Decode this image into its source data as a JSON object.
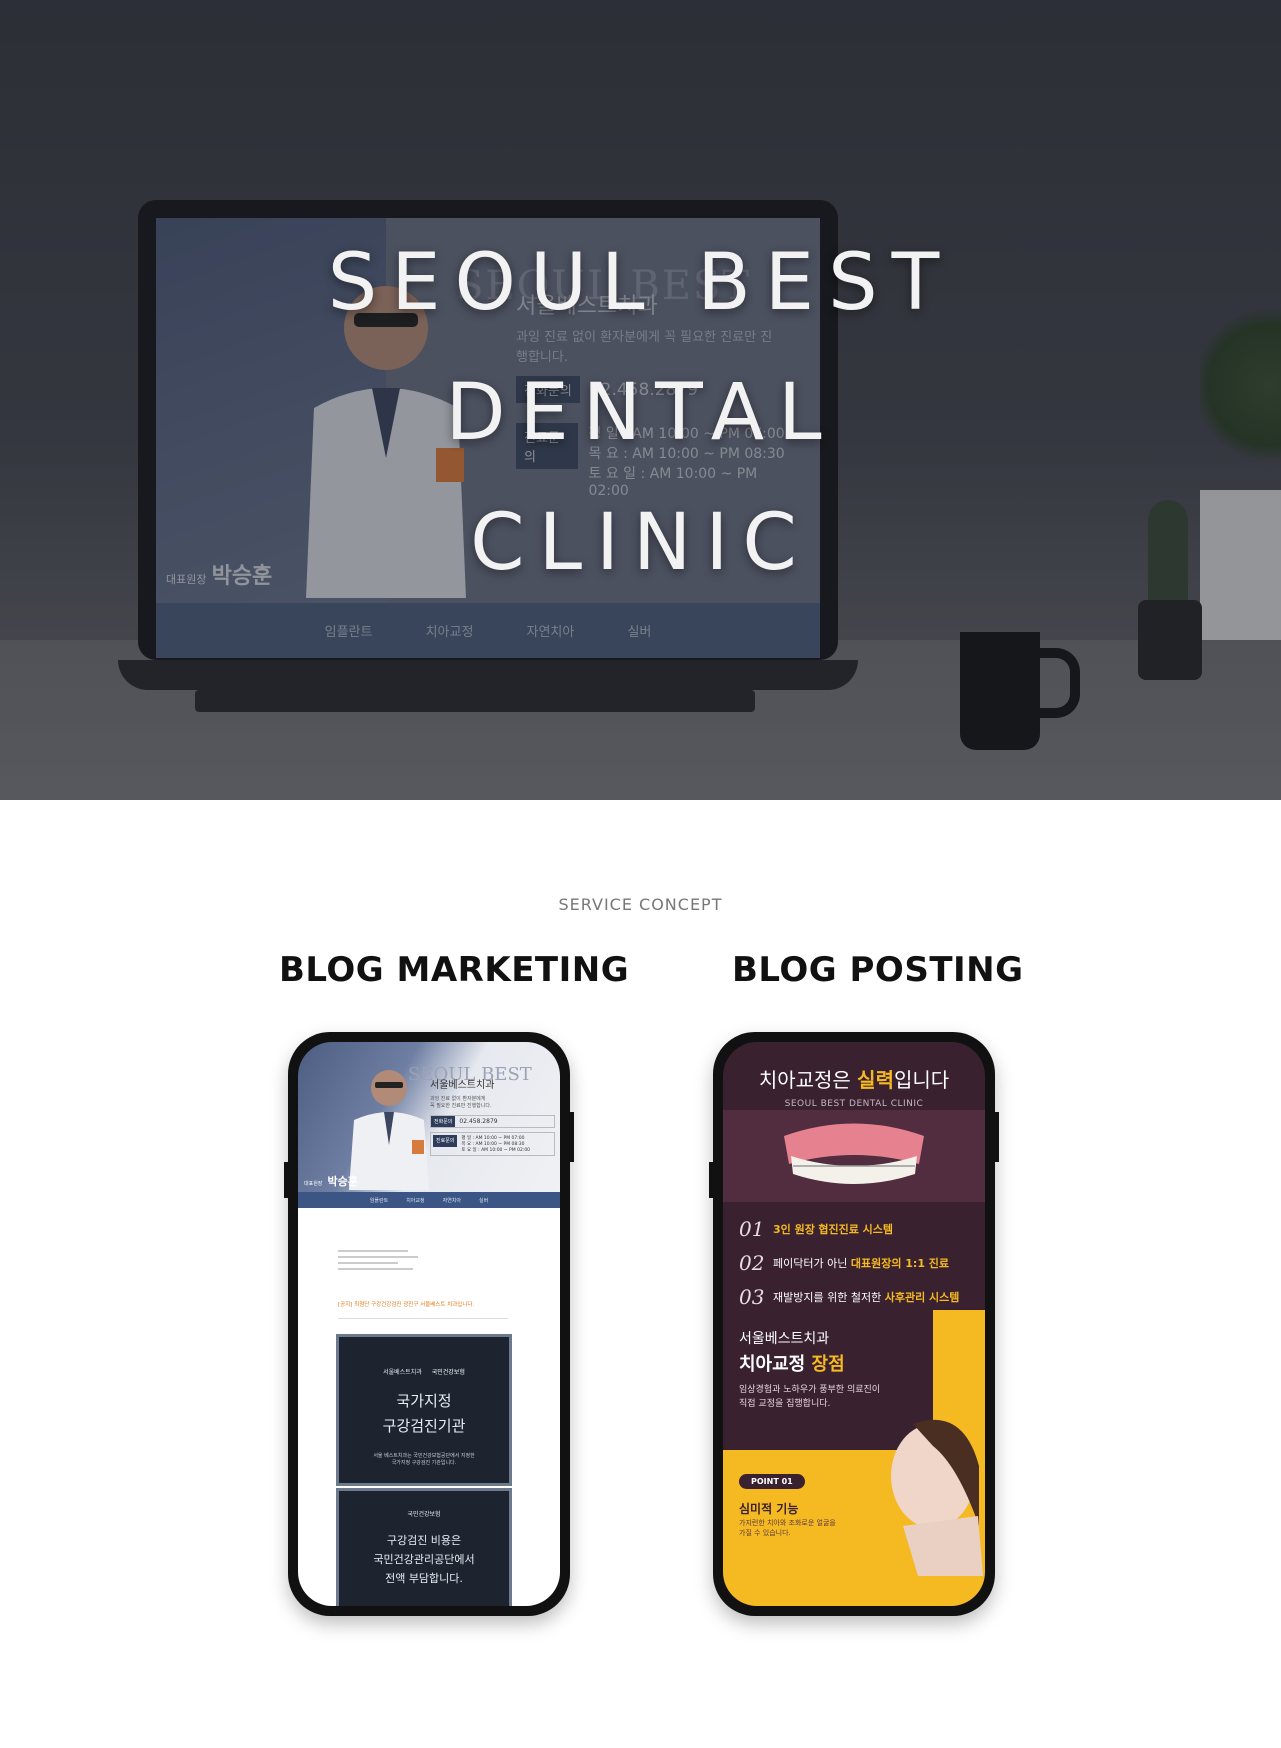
{
  "hero": {
    "title_line1": "SEOUL BEST",
    "title_line2": "DENTAL",
    "title_line3": "CLINIC",
    "laptop_screen": {
      "bg_text": "SEOUL BEST",
      "clinic_name": "서울베스트치과",
      "tagline": "과잉 진료 없이 환자분에게 꼭 필요한 진료만 진행합니다.",
      "phone_label": "전화문의",
      "phone_value": "02.458.2879",
      "hours_label": "진료문의",
      "hours_line1": "평     일 : AM 10:00 ~ PM 07:00",
      "hours_line2": "목     요 : AM 10:00 ~ PM 08:30",
      "hours_line3": "토 요 일 : AM 10:00 ~ PM 02:00",
      "doctor_title": "대표원장",
      "doctor_name": "박승훈",
      "nav": [
        "임플란트",
        "치아교정",
        "자연치아",
        "실버"
      ]
    }
  },
  "section": {
    "label": "SERVICE CONCEPT",
    "left_title": "BLOG MARKETING",
    "right_title": "BLOG POSTING"
  },
  "left_phone": {
    "bg_text": "SEOUL BEST",
    "clinic_name": "서울베스트치과",
    "tagline1": "과잉 진료 없이 환자분에게",
    "tagline2": "꼭 필요한 진료만 진행합니다.",
    "phone_label": "전화문의",
    "phone_value": "02.458.2879",
    "hours_label": "진료문의",
    "hours1": "평   일 : AM 10:00 ~ PM 07:00",
    "hours2": "목   요 : AM 10:00 ~ PM 08:30",
    "hours3": "토 요 일 : AM 10:00 ~ PM 02:00",
    "doctor_title": "대표원장",
    "doctor_name": "박승훈",
    "nav": [
      "임플란트",
      "치아교정",
      "자연치아",
      "실버"
    ],
    "post_title": "[공지] 최첨단 구강건강검진 광진구 서울베스트 치과입니다.",
    "card1_logo": "서울베스트치과",
    "card1_partner": "국민건강보험",
    "card1_title1": "국가지정",
    "card1_title2": "구강검진기관",
    "card1_desc1": "서울 베스트치과는 국민건강보험공단에서 지정한",
    "card1_desc2": "국가지정 구강검진 기관입니다.",
    "card2_logo": "국민건강보험",
    "card2_line1": "구강검진 비용은",
    "card2_line2": "국민건강관리공단에서",
    "card2_line3": "전액 부담합니다."
  },
  "right_phone": {
    "headline_pre": "치아교정은 ",
    "headline_hl": "실력",
    "headline_post": "입니다",
    "subtitle": "SEOUL BEST DENTAL CLINIC",
    "items": [
      {
        "num": "01",
        "pre": "3인 원장 ",
        "hl": "협진진료 시스템",
        "post": ""
      },
      {
        "num": "02",
        "pre": "페이닥터가 아닌 ",
        "hl": "대표원장의 1:1 진료",
        "post": ""
      },
      {
        "num": "03",
        "pre": "재발방지를 위한 철저한 ",
        "hl": "사후관리 시스템",
        "post": ""
      }
    ],
    "clinic": "서울베스트치과",
    "strength_pre": "치아교정 ",
    "strength_hl": "장점",
    "desc1": "임상경험과 노하우가 풍부한 의료진이",
    "desc2": "직접 교정을 집행합니다.",
    "point_badge": "POINT 01",
    "point_title": "심미적 기능",
    "point_desc1": "가지런한 치아와 조화로운 얼굴을",
    "point_desc2": "가질 수 있습니다."
  },
  "colors": {
    "accent_yellow": "#f5b921",
    "plum": "#3a2130",
    "navy": "#3b5585"
  }
}
